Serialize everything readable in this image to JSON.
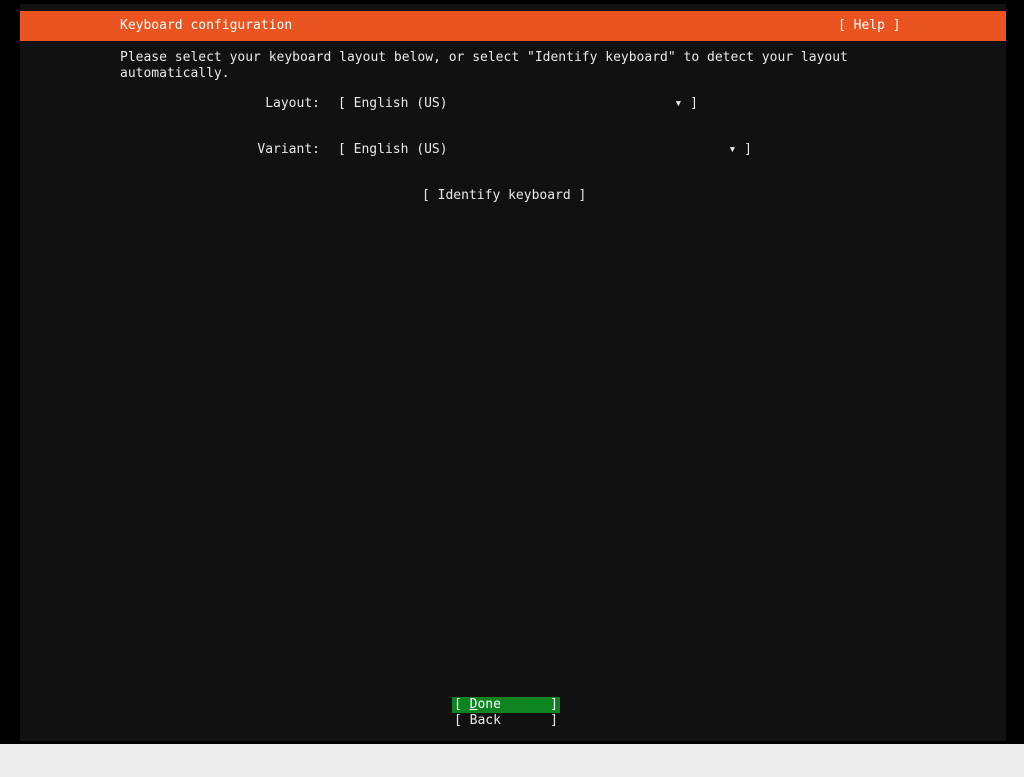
{
  "header": {
    "title": "Keyboard configuration",
    "help_label": "[ Help ]"
  },
  "instructions": "Please select your keyboard layout below, or select \"Identify keyboard\" to detect your layout automatically.",
  "layout": {
    "label": "Layout:",
    "value": "[ English (US)",
    "arrow": "▾ ]"
  },
  "variant": {
    "label": "Variant:",
    "value": "[ English (US)",
    "arrow": "▾ ]"
  },
  "identify_button": "[ Identify keyboard ]",
  "buttons": {
    "done_open": "[ ",
    "done_label": "Done",
    "done_close": "]",
    "back_open": "[ ",
    "back_label": "Back",
    "back_close": "]"
  },
  "colors": {
    "header_bg": "#e95420",
    "done_bg": "#0e8420",
    "screen_bg": "#111111"
  }
}
